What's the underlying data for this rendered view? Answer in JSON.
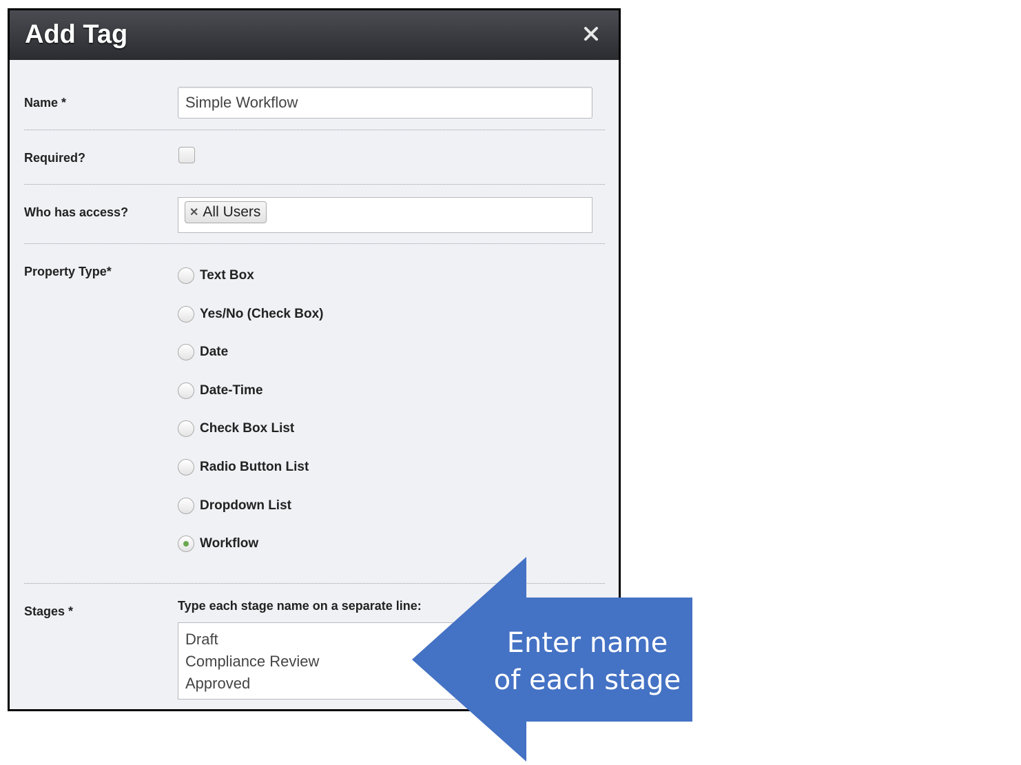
{
  "dialog": {
    "title": "Add Tag",
    "close_icon": "close-icon"
  },
  "form": {
    "name_label": "Name *",
    "name_value": "Simple Workflow",
    "required_label": "Required?",
    "required_checked": false,
    "access_label": "Who has access?",
    "access_tags": [
      "All Users"
    ],
    "property_type_label": "Property Type*",
    "property_types": [
      {
        "label": "Text Box",
        "checked": false
      },
      {
        "label": "Yes/No (Check Box)",
        "checked": false
      },
      {
        "label": "Date",
        "checked": false
      },
      {
        "label": "Date-Time",
        "checked": false
      },
      {
        "label": "Check Box List",
        "checked": false
      },
      {
        "label": "Radio Button List",
        "checked": false
      },
      {
        "label": "Dropdown List",
        "checked": false
      },
      {
        "label": "Workflow",
        "checked": true
      }
    ],
    "stages_label": "Stages *",
    "stages_hint": "Type each stage name on a separate line:",
    "stages_lines": [
      "Draft",
      "Compliance Review",
      "Approved"
    ]
  },
  "callout": {
    "line1": "Enter name",
    "line2": "of each stage",
    "color": "#4472c4"
  }
}
